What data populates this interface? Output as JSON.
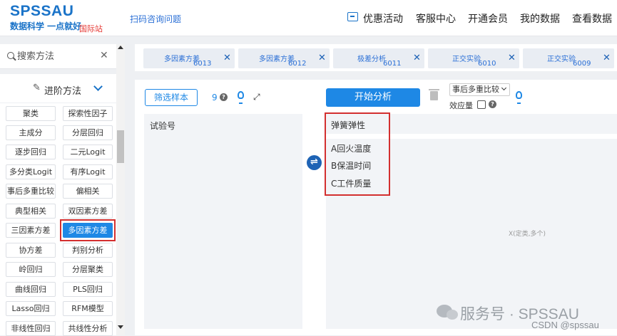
{
  "header": {
    "logo": "SPSSAU",
    "logo_sub": "数据科学 一点就好",
    "logo_intl": "国际站",
    "scan_link": "扫码咨询问题",
    "nav": [
      "优惠活动",
      "客服中心",
      "开通会员",
      "我的数据",
      "查看数据"
    ]
  },
  "sidebar": {
    "search_placeholder": "搜索方法",
    "section_label": "进阶方法",
    "methods": [
      [
        "聚类",
        "探索性因子"
      ],
      [
        "主成分",
        "分层回归"
      ],
      [
        "逐步回归",
        "二元Logit"
      ],
      [
        "多分类Logit",
        "有序Logit"
      ],
      [
        "事后多重比较",
        "偏相关"
      ],
      [
        "典型相关",
        "双因素方差"
      ],
      [
        "三因素方差",
        "多因素方差"
      ],
      [
        "协方差",
        "判别分析"
      ],
      [
        "岭回归",
        "分层聚类"
      ],
      [
        "曲线回归",
        "PLS回归"
      ],
      [
        "Lasso回归",
        "RFM模型"
      ],
      [
        "非线性回归",
        "共线性分析"
      ]
    ],
    "active_method": "多因素方差"
  },
  "tabs": [
    {
      "label": "多因素方差",
      "num": "6013"
    },
    {
      "label": "多因素方差",
      "num": "6012"
    },
    {
      "label": "极差分析",
      "num": "6011"
    },
    {
      "label": "正交实验",
      "num": "6010"
    },
    {
      "label": "正交实验",
      "num": "6009"
    }
  ],
  "toolbar": {
    "filter_button": "筛选样本",
    "count": "9",
    "start_button": "开始分析",
    "select_value": "事后多重比较",
    "effect_label": "效应量"
  },
  "panels": {
    "left_header": "试验号",
    "y_var": "弹簧弹性",
    "x_vars": [
      "A回火温度",
      "B保温时间",
      "C工件质量"
    ],
    "x_hint": "X(定类,多个)"
  },
  "watermark": {
    "text": "服务号 · SPSSAU",
    "csdn": "CSDN @spssau"
  },
  "colors": {
    "brand": "#1a73c8",
    "primary_button": "#1e88e5",
    "highlight_border": "#d32f2f"
  }
}
